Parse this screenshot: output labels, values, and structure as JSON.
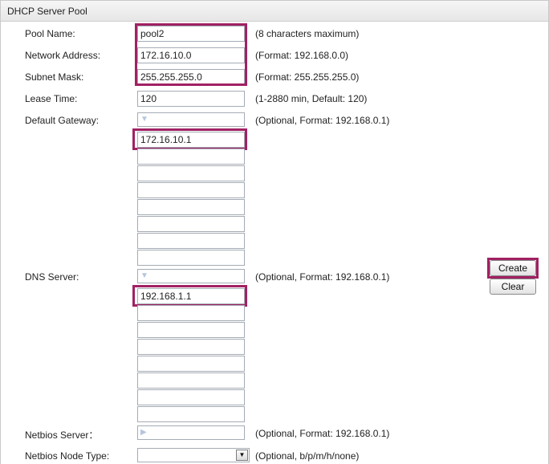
{
  "panel": {
    "title": "DHCP Server Pool"
  },
  "pool_name": {
    "label": "Pool Name:",
    "value": "pool2",
    "hint": "(8 characters maximum)"
  },
  "network_address": {
    "label": "Network Address:",
    "value": "172.16.10.0",
    "hint": "(Format: 192.168.0.0)"
  },
  "subnet_mask": {
    "label": "Subnet Mask:",
    "value": "255.255.255.0",
    "hint": "(Format: 255.255.255.0)"
  },
  "lease_time": {
    "label": "Lease Time:",
    "value": "120",
    "hint": "(1-2880 min, Default: 120)"
  },
  "default_gateway": {
    "label": "Default Gateway:",
    "hint": "(Optional, Format: 192.168.0.1)",
    "toggle_icon": "triangle-down-icon",
    "entries": [
      "172.16.10.1",
      "",
      "",
      "",
      "",
      "",
      "",
      ""
    ]
  },
  "dns_server": {
    "label": "DNS Server:",
    "hint": "(Optional, Format: 192.168.0.1)",
    "toggle_icon": "triangle-down-icon",
    "entries": [
      "192.168.1.1",
      "",
      "",
      "",
      "",
      "",
      "",
      ""
    ]
  },
  "netbios_server": {
    "label": "Netbios Server：",
    "hint": "(Optional, Format: 192.168.0.1)",
    "toggle_icon": "triangle-right-icon"
  },
  "netbios_node_type": {
    "label": "Netbios Node Type:",
    "value": "",
    "hint": "(Optional, b/p/m/h/none)"
  },
  "buttons": {
    "create": "Create",
    "clear": "Clear"
  },
  "colors": {
    "highlight": "#a12163",
    "field_border": "#a5acb5",
    "header_bg": "#ececec"
  }
}
